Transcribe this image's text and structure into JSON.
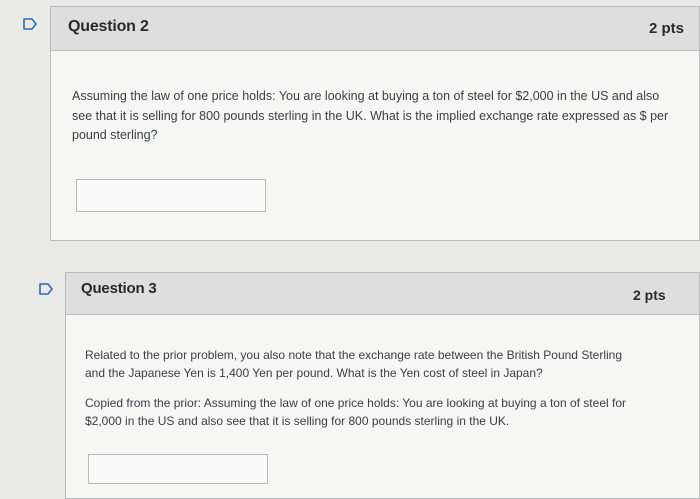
{
  "question2": {
    "title": "Question 2",
    "points": "2 pts",
    "text": "Assuming the law of one price holds: You are looking at buying a ton of steel for $2,000 in the US and also see that it is selling for 800 pounds sterling in the UK. What is the implied exchange rate expressed as $ per pound sterling?",
    "answer_value": ""
  },
  "question3": {
    "title": "Question 3",
    "points": "2 pts",
    "text_1": "Related to the prior problem, you also note that the exchange rate between the British Pound Sterling and the Japanese Yen is 1,400 Yen per pound. What is the Yen cost of steel in Japan?",
    "text_2": "Copied from the prior: Assuming the law of one price holds: You are looking at buying a ton of steel for $2,000 in the US and also see that it is selling for 800 pounds sterling in the UK.",
    "answer_value": ""
  },
  "icons": {
    "flag": "flag-icon"
  }
}
